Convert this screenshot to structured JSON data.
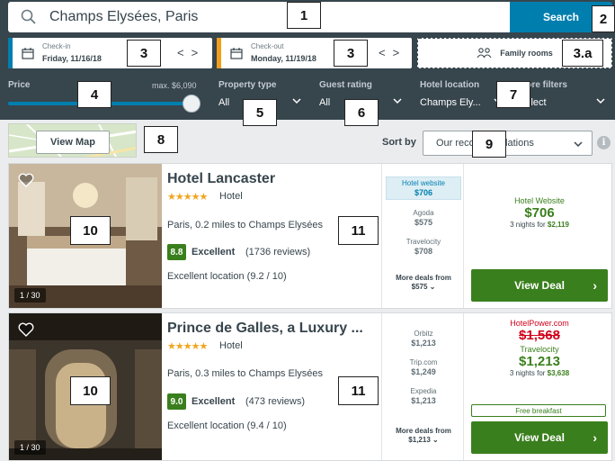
{
  "search": {
    "query": "Champs Elysées, Paris",
    "button_label": "Search"
  },
  "dates": {
    "checkin": {
      "label": "Check-in",
      "value": "Friday, 11/16/18"
    },
    "checkout": {
      "label": "Check-out",
      "value": "Monday, 11/19/18"
    },
    "prev_arrow": "<",
    "next_arrow": ">"
  },
  "family": {
    "label": "Family rooms"
  },
  "filters": {
    "price": {
      "label": "Price",
      "max_label": "max. $6,090",
      "slider_fraction": 1.0
    },
    "property_type": {
      "label": "Property type",
      "value": "All"
    },
    "guest_rating": {
      "label": "Guest rating",
      "value": "All"
    },
    "hotel_location": {
      "label": "Hotel location",
      "value": "Champs Ely..."
    },
    "more_filters": {
      "label": "More filters",
      "value": "Select"
    }
  },
  "map": {
    "button_label": "View Map"
  },
  "sort": {
    "label": "Sort by",
    "value": "Our recommendations",
    "info_glyph": "i"
  },
  "hotels": [
    {
      "name": "Hotel Lancaster",
      "stars": "★★★★★",
      "type": "Hotel",
      "location": "Paris, 0.2 miles to Champs Elysées",
      "rating": "8.8",
      "rating_word": "Excellent",
      "reviews": "(1736 reviews)",
      "location_rating": "Excellent location (9.2 / 10)",
      "photo_count": "1 / 30",
      "deals": [
        {
          "site": "Hotel website",
          "price": "$706"
        },
        {
          "site": "Agoda",
          "price": "$575"
        },
        {
          "site": "Travelocity",
          "price": "$708"
        }
      ],
      "more_deals": {
        "label": "More deals from",
        "price": "$575 ⌄"
      },
      "best": {
        "site": "Hotel Website",
        "price": "$706",
        "nights_text": "3 nights for",
        "nights_total": "$2,119"
      },
      "view_deal": "View Deal"
    },
    {
      "name": "Prince de Galles, a Luxury ...",
      "stars": "★★★★★",
      "type": "Hotel",
      "location": "Paris, 0.3 miles to Champs Elysées",
      "rating": "9.0",
      "rating_word": "Excellent",
      "reviews": "(473 reviews)",
      "location_rating": "Excellent location (9.4 / 10)",
      "photo_count": "1 / 30",
      "deals": [
        {
          "site": "Orbitz",
          "price": "$1,213"
        },
        {
          "site": "Trip.com",
          "price": "$1,249"
        },
        {
          "site": "Expedia",
          "price": "$1,213"
        }
      ],
      "more_deals": {
        "label": "More deals from",
        "price": "$1,213 ⌄"
      },
      "best": {
        "strike_site": "HotelPower.com",
        "strike_price": "$1,568",
        "site": "Travelocity",
        "price": "$1,213",
        "nights_text": "3 nights for",
        "nights_total": "$3,638",
        "perk": "Free breakfast"
      },
      "view_deal": "View Deal"
    }
  ],
  "annotations": [
    "1",
    "2",
    "3",
    "3",
    "3.a",
    "4",
    "5",
    "6",
    "7",
    "8",
    "9",
    "10",
    "11",
    "10",
    "11"
  ],
  "colors": {
    "accent_blue": "#007faf",
    "checkout_orange": "#f29e1b",
    "deal_green": "#3a7f1d",
    "header_dark": "#37454d",
    "strike_red": "#d0021b"
  }
}
